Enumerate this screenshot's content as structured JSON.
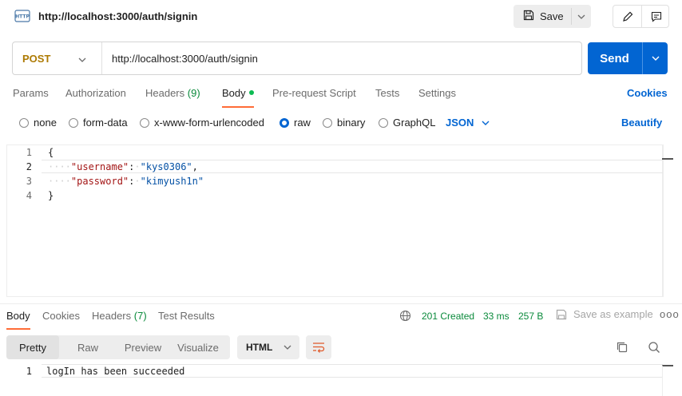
{
  "header": {
    "title": "http://localhost:3000/auth/signin",
    "save_label": "Save"
  },
  "request": {
    "method": "POST",
    "url": "http://localhost:3000/auth/signin",
    "send_label": "Send"
  },
  "request_tabs": {
    "params": "Params",
    "authorization": "Authorization",
    "headers": "Headers",
    "headers_count": "(9)",
    "body": "Body",
    "prerequest": "Pre-request Script",
    "tests": "Tests",
    "settings": "Settings",
    "cookies": "Cookies"
  },
  "body_types": {
    "none": "none",
    "form_data": "form-data",
    "urlencoded": "x-www-form-urlencoded",
    "raw": "raw",
    "binary": "binary",
    "graphql": "GraphQL",
    "selected": "raw",
    "format": "JSON",
    "beautify": "Beautify"
  },
  "editor": {
    "line_numbers": [
      "1",
      "2",
      "3",
      "4"
    ],
    "open_brace": "{",
    "close_brace": "}",
    "key1": "\"username\"",
    "val1": "\"kys0306\"",
    "key2": "\"password\"",
    "val2": "\"kimyush1n\""
  },
  "response": {
    "tabs": {
      "body": "Body",
      "cookies": "Cookies",
      "headers": "Headers",
      "headers_count": "(7)",
      "test_results": "Test Results"
    },
    "status": "201 Created",
    "time": "33 ms",
    "size": "257 B",
    "save_example": "Save as example",
    "more": "ooo",
    "views": {
      "pretty": "Pretty",
      "raw": "Raw",
      "preview": "Preview",
      "visualize": "Visualize"
    },
    "format": "HTML",
    "line_number": "1",
    "body_text": "logIn has been succeeded"
  },
  "colors": {
    "accent_orange": "#ff6c37",
    "primary_blue": "#0265d2",
    "method_post": "#ad7a03",
    "success_green": "#0a8a3b"
  }
}
